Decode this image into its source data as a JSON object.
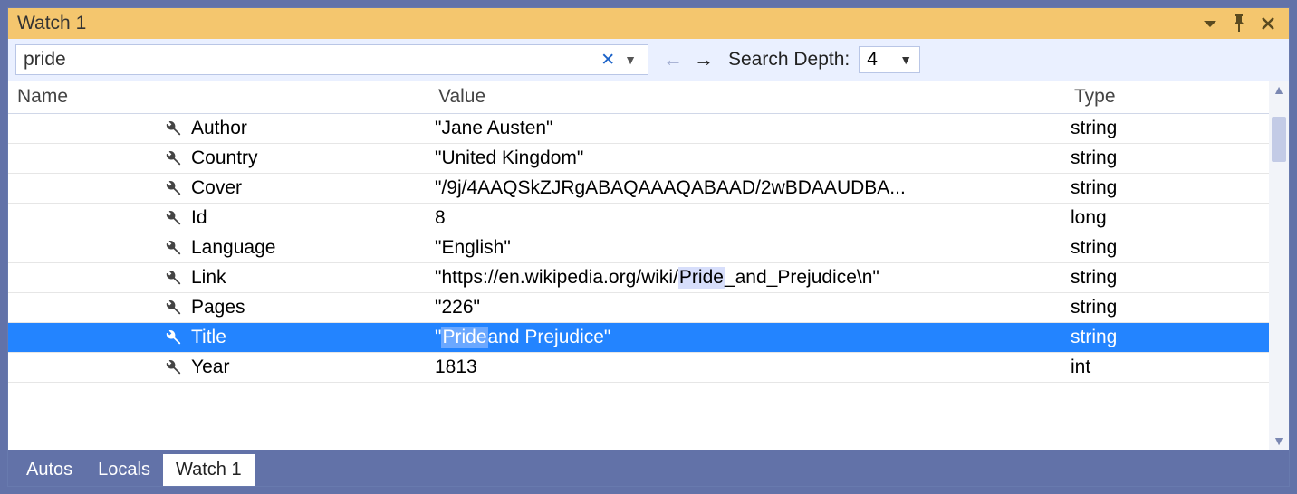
{
  "title": "Watch 1",
  "search": {
    "value": "pride",
    "depth_label": "Search Depth:",
    "depth_value": "4"
  },
  "columns": {
    "name": "Name",
    "value": "Value",
    "type": "Type"
  },
  "rows": [
    {
      "name": "Author",
      "value": "\"Jane Austen\"",
      "type": "string",
      "selected": false,
      "highlight": ""
    },
    {
      "name": "Country",
      "value": "\"United Kingdom\"",
      "type": "string",
      "selected": false,
      "highlight": ""
    },
    {
      "name": "Cover",
      "value": "\"/9j/4AAQSkZJRgABAQAAAQABAAD/2wBDAAUDBA...",
      "type": "string",
      "selected": false,
      "highlight": ""
    },
    {
      "name": "Id",
      "value": "8",
      "type": "long",
      "selected": false,
      "highlight": ""
    },
    {
      "name": "Language",
      "value": "\"English\"",
      "type": "string",
      "selected": false,
      "highlight": ""
    },
    {
      "name": "Link",
      "value": "\"https://en.wikipedia.org/wiki/Pride_and_Prejudice\\n\"",
      "type": "string",
      "selected": false,
      "highlight": "Pride"
    },
    {
      "name": "Pages",
      "value": "\"226\"",
      "type": "string",
      "selected": false,
      "highlight": ""
    },
    {
      "name": "Title",
      "value": "\"Pride and Prejudice\"",
      "type": "string",
      "selected": true,
      "highlight": "Pride"
    },
    {
      "name": "Year",
      "value": "1813",
      "type": "int",
      "selected": false,
      "highlight": ""
    }
  ],
  "tabs": [
    {
      "label": "Autos",
      "active": false
    },
    {
      "label": "Locals",
      "active": false
    },
    {
      "label": "Watch 1",
      "active": true
    }
  ]
}
